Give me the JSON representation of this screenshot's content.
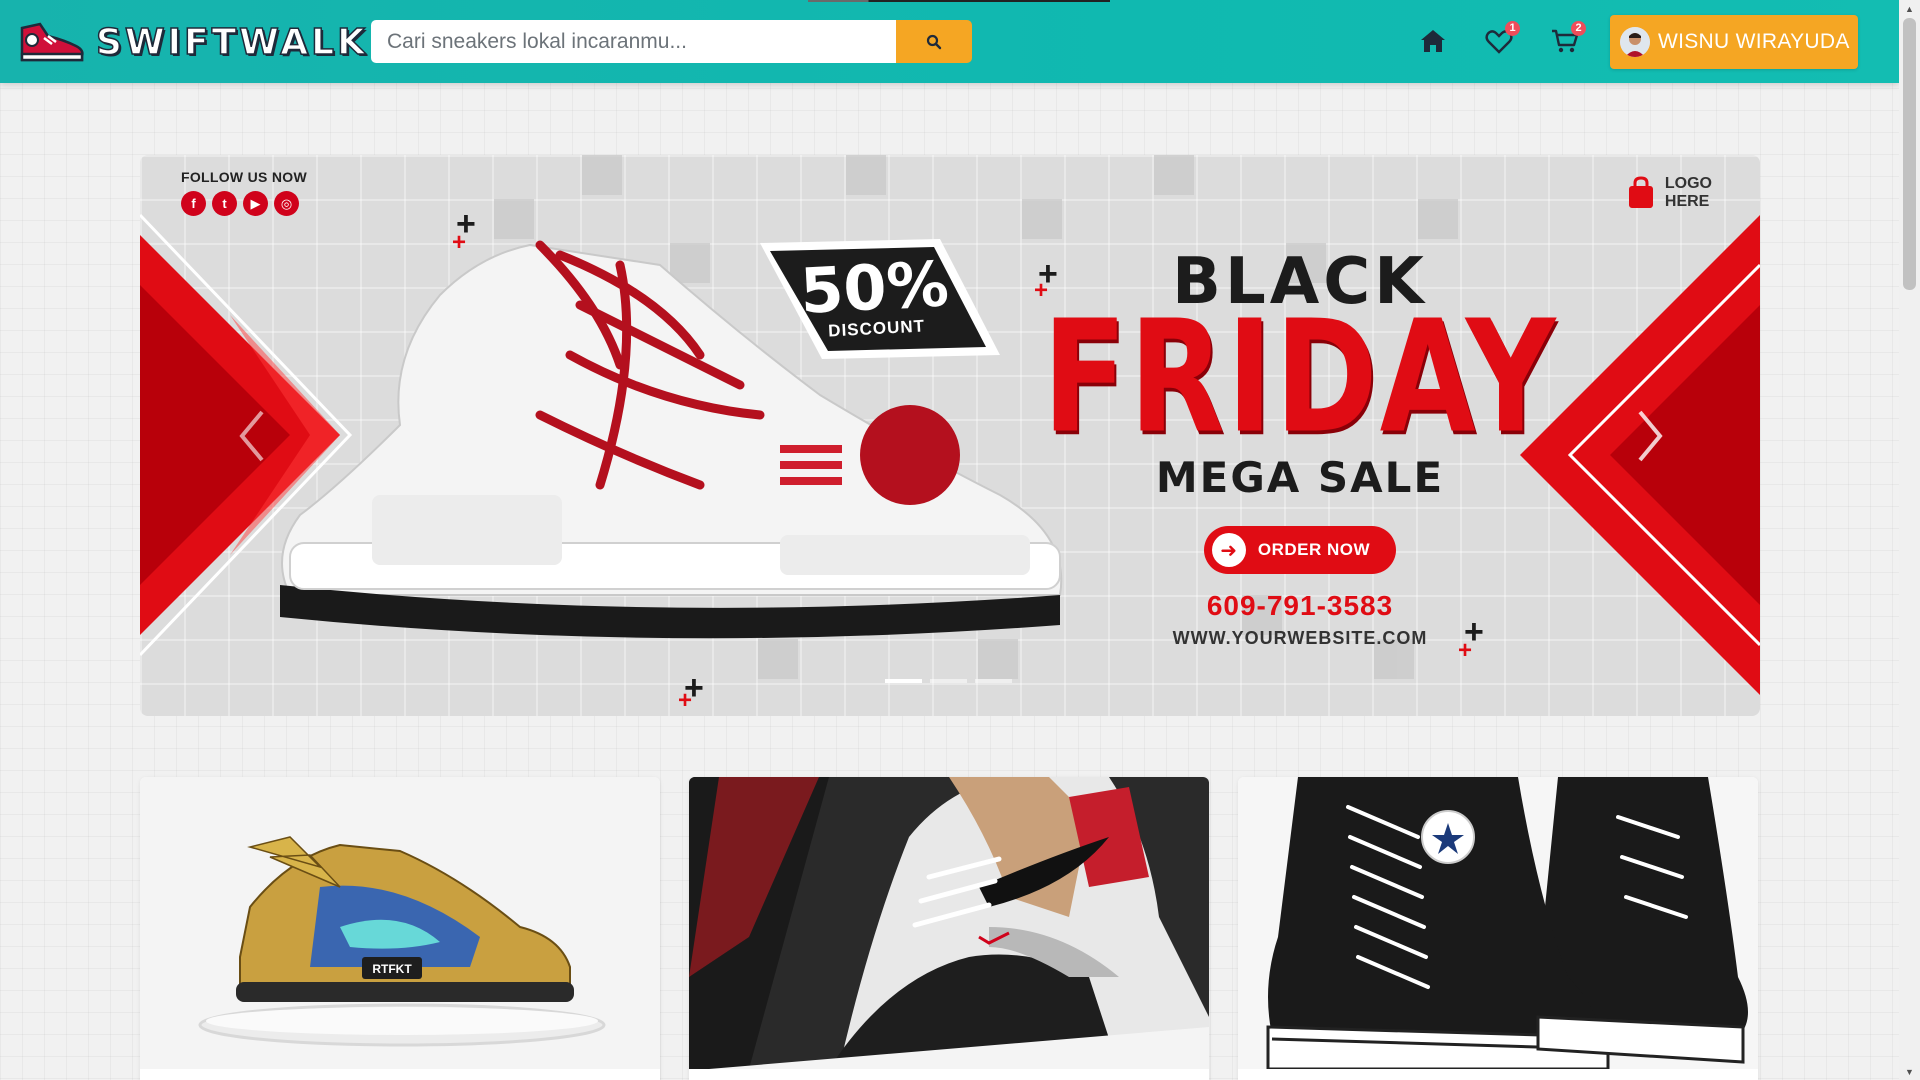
{
  "brand": {
    "name": "SWIFTWALK"
  },
  "search": {
    "placeholder": "Cari sneakers lokal incaranmu..."
  },
  "nav": {
    "wishlist_count": "1",
    "cart_count": "2",
    "user_name": "WISNU WIRAYUDA"
  },
  "banner": {
    "follow_label": "FOLLOW US NOW",
    "socials": [
      "f",
      "t",
      "▶",
      "◎"
    ],
    "logo_text": "LOGO\nHERE",
    "discount_number": "50%",
    "discount_word": "DISCOUNT",
    "line_1": "BLACK",
    "line_2": "FRIDAY",
    "line_3": "MEGA SALE",
    "button_label": "ORDER NOW",
    "phone": "609-791-3583",
    "website": "WWW.YOURWEBSITE.COM",
    "slide_count": 3,
    "active_slide": 1
  },
  "products": [
    {
      "icon": "rtfkt-gold-sneaker",
      "tag": "RTFKT"
    },
    {
      "icon": "red-black-sneaker"
    },
    {
      "icon": "black-high-top-sneaker"
    }
  ],
  "colors": {
    "navbar": "#17b3ad",
    "accent_orange": "#f5a623",
    "badge_red": "#ee4d5a",
    "banner_red": "#e00c14"
  }
}
